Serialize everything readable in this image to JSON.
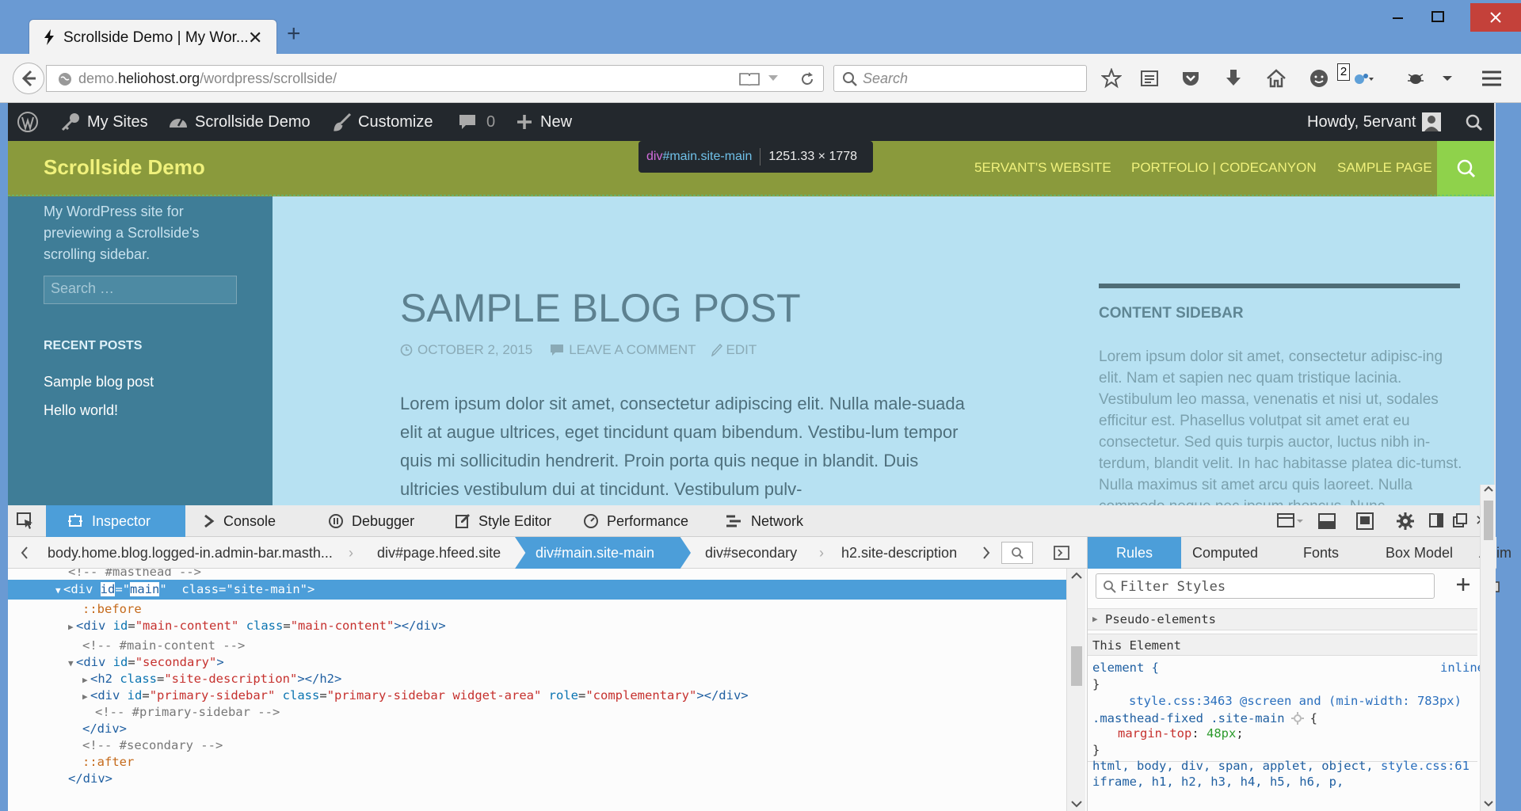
{
  "browser": {
    "tab_title": "Scrollside Demo | My Wor...",
    "url_domain_prefix": "demo.",
    "url_domain": "heliohost.org",
    "url_path": "/wordpress/scrollside/",
    "search_placeholder": "Search",
    "download_badge": "2"
  },
  "admin_bar": {
    "my_sites": "My Sites",
    "site_name": "Scrollside Demo",
    "customize": "Customize",
    "comments_count": "0",
    "new": "New",
    "howdy": "Howdy, 5ervant"
  },
  "site": {
    "title": "Scrollside Demo",
    "menu": [
      "5ERVANT'S WEBSITE",
      "PORTFOLIO | CODECANYON",
      "SAMPLE PAGE"
    ],
    "description": "My WordPress site for previewing a Scrollside's scrolling sidebar.",
    "search_placeholder": "Search …",
    "recent_posts_title": "RECENT POSTS",
    "recent_posts": [
      "Sample blog post",
      "Hello world!"
    ],
    "post_title": "SAMPLE BLOG POST",
    "post_date": "OCTOBER 2, 2015",
    "post_comment": "LEAVE A COMMENT",
    "post_edit": "EDIT",
    "post_body": "Lorem ipsum dolor sit amet, consectetur adipiscing elit. Nulla male-suada elit at augue ultrices, eget tincidunt quam bibendum. Vestibu-lum tempor quis mi sollicitudin hendrerit. Proin porta quis neque in blandit. Duis ultricies vestibulum dui at tincidunt. Vestibulum pulv-",
    "sidebar_title": "CONTENT SIDEBAR",
    "sidebar_body": "Lorem ipsum dolor sit amet, consectetur adipisc-ing elit. Nam et sapien nec quam tristique lacinia. Vestibulum leo massa, venenatis et nisi ut, sodales efficitur est. Phasellus volutpat sit amet erat eu consectetur. Sed quis turpis auctor, luctus nibh in-terdum, blandit velit. In hac habitasse platea dic-tumst. Nulla maximus sit amet arcu quis laoreet. Nulla commodo neque nec ipsum rhoncus. Nunc"
  },
  "highlighter": {
    "tag": "div",
    "id": "#main",
    "cls": ".site-main",
    "dims": "1251.33 × 1778"
  },
  "devtools": {
    "tabs": [
      "Inspector",
      "Console",
      "Debugger",
      "Style Editor",
      "Performance",
      "Network"
    ],
    "breadcrumbs": [
      "body.home.blog.logged-in.admin-bar.masth...",
      "div#page.hfeed.site",
      "div#main.site-main",
      "div#secondary",
      "h2.site-description"
    ],
    "side_tabs": [
      "Rules",
      "Computed",
      "Fonts",
      "Box Model",
      "Anim"
    ],
    "filter_placeholder": "Filter Styles",
    "pseudo_elements": "Pseudo-elements",
    "this_element": "This Element",
    "element_rule": "element {",
    "inline": "inline",
    "close_brace": "}",
    "rule_source": "style.css:3463",
    "rule_media": "@screen and (min-width: 783px)",
    "rule_selector": ".masthead-fixed .site-main",
    "rule_open": "{",
    "rule_prop": "margin-top",
    "rule_value": "48px",
    "next_selector": "html, body, div, span, applet, object,",
    "next_source": "style.css:61",
    "next_selector2": "iframe, h1, h2, h3, h4, h5, h6, p,"
  },
  "markup": {
    "l0": "<!-- #masthead -->",
    "l2": "::before",
    "l4": "<!-- #main-content -->",
    "l7": "<!-- #primary-sidebar -->",
    "l8": "</div>",
    "l9": "<!-- #secondary -->",
    "l10": "::after",
    "l11": "</div>"
  }
}
